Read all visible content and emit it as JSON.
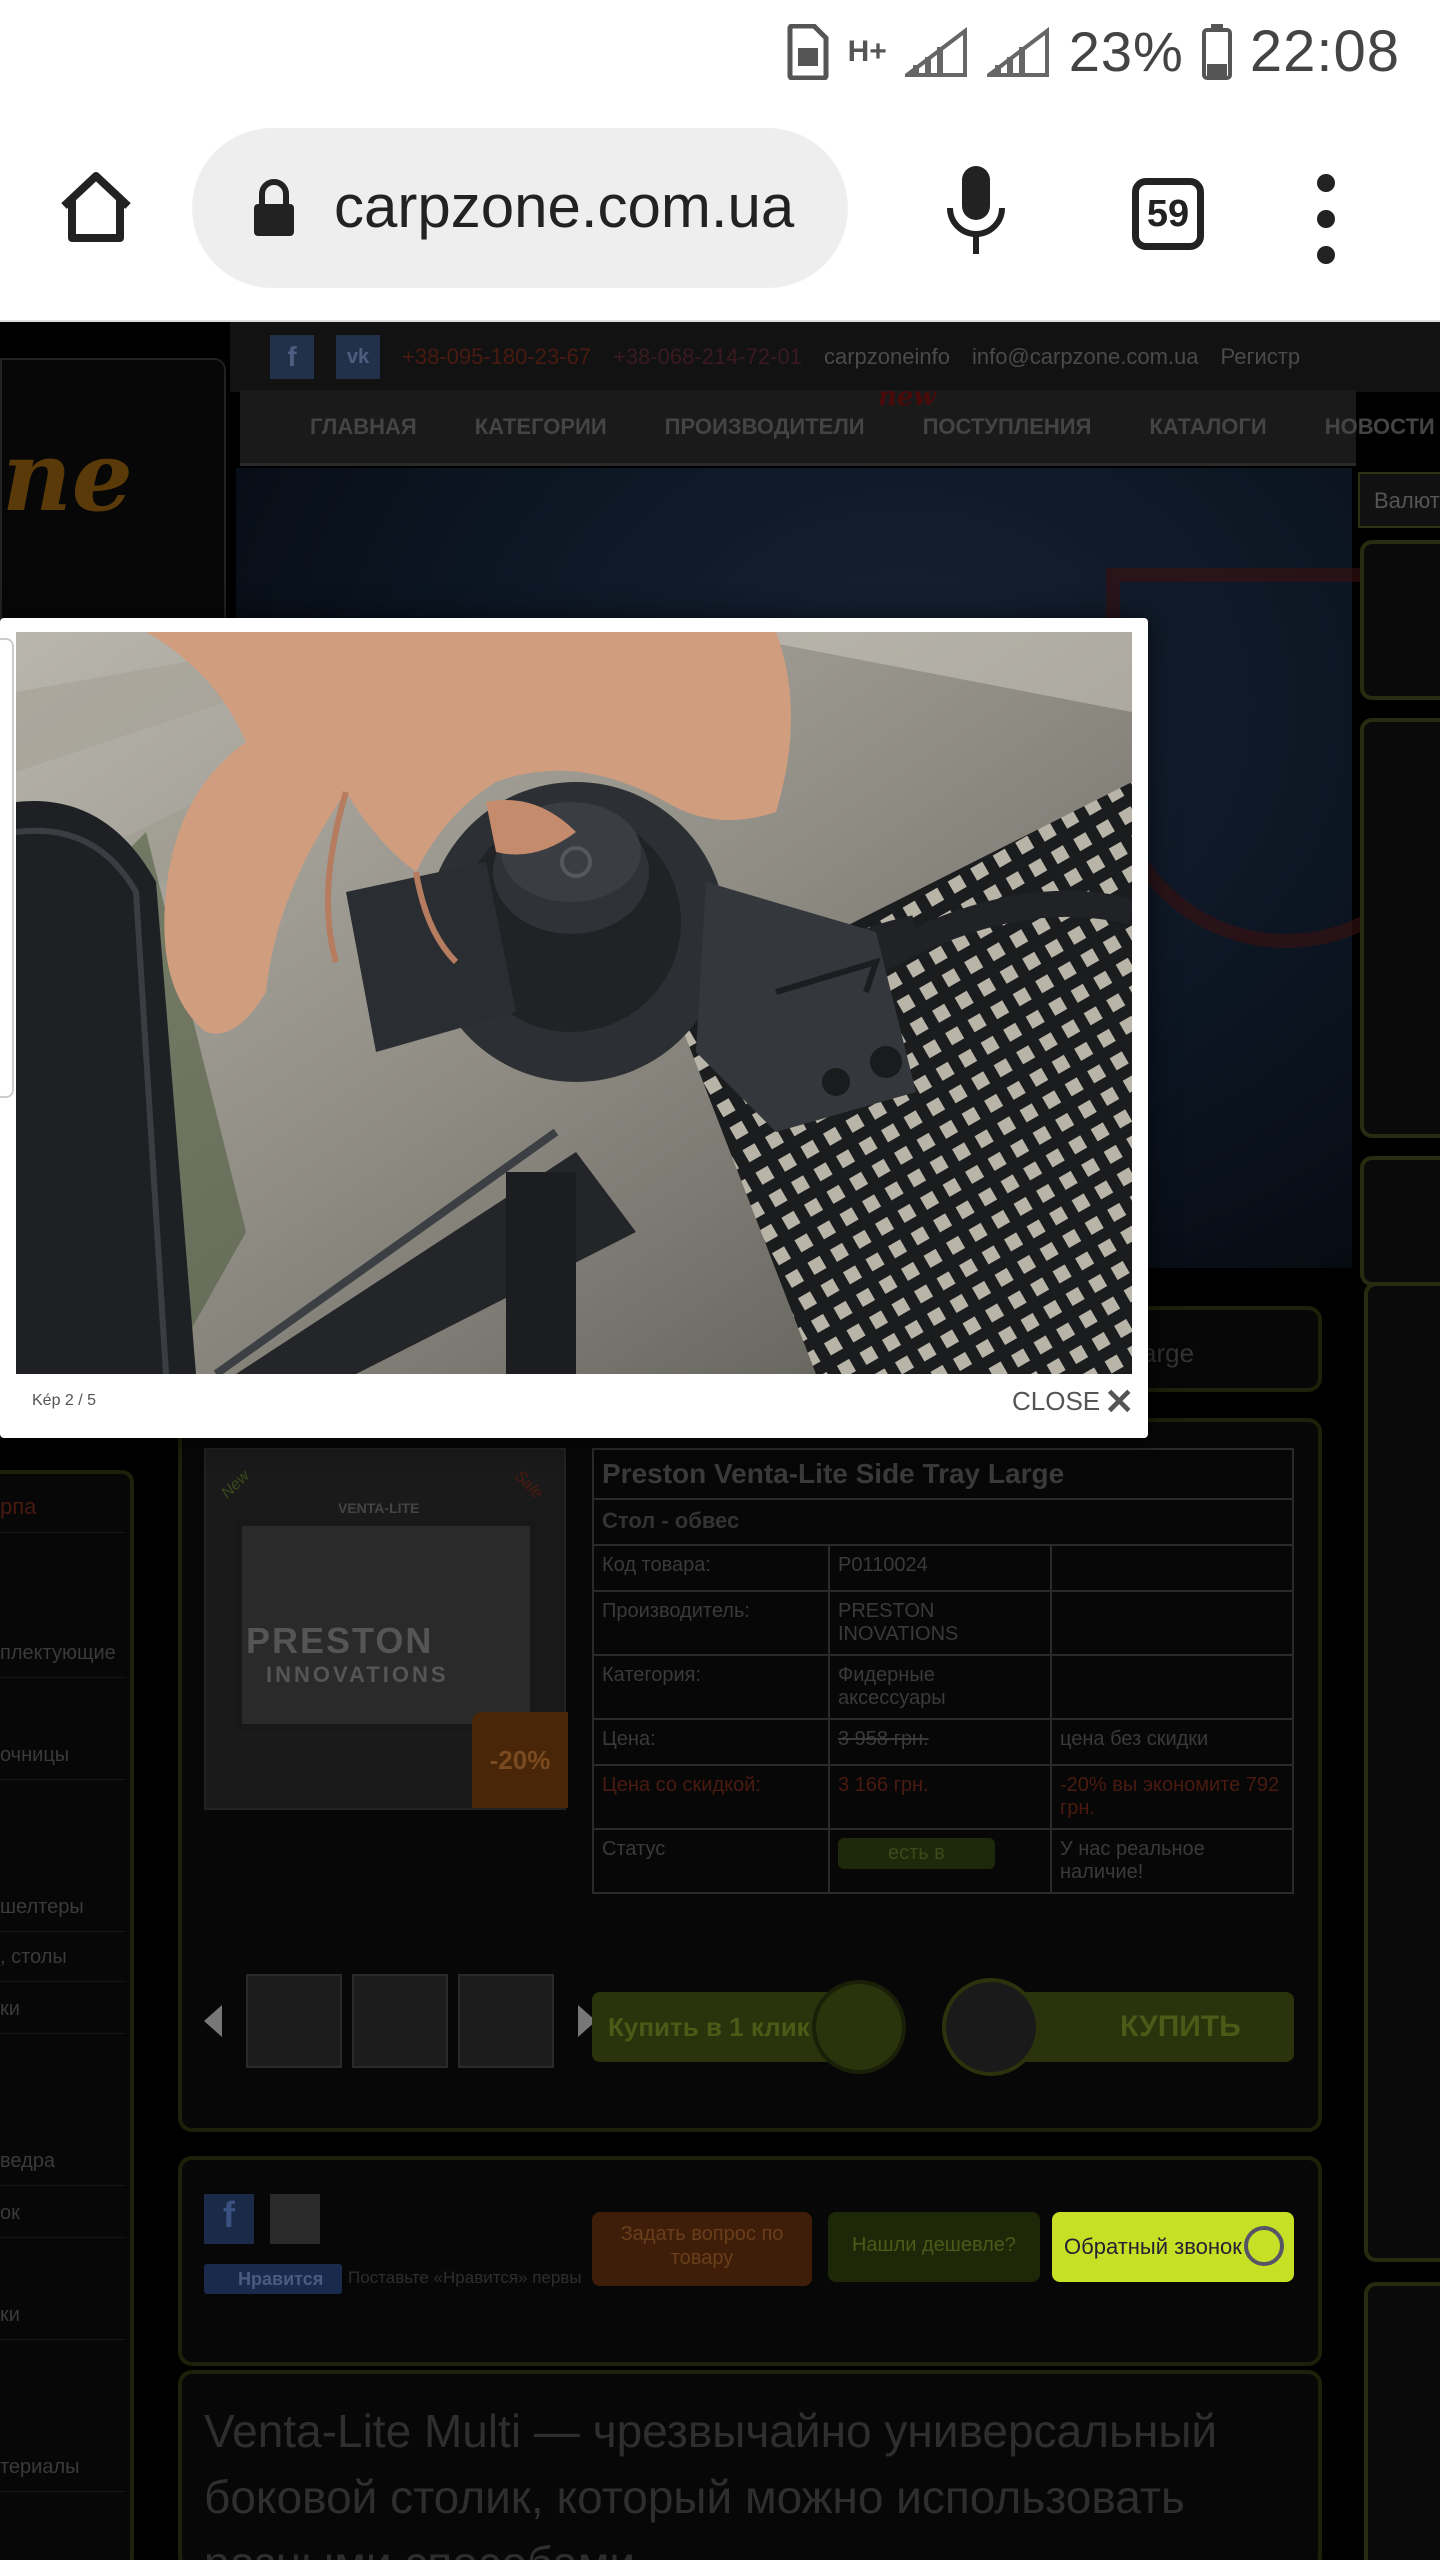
{
  "status_bar": {
    "network": "H+",
    "battery_pct": "23%",
    "time": "22:08"
  },
  "browser": {
    "url": "carpzone.com.ua",
    "tab_count": "59"
  },
  "site": {
    "topbar": {
      "phone1": "+38-095-180-23-67",
      "phone2": "+38-068-214-72-01",
      "skype": "carpzoneinfo",
      "email": "info@carpzone.com.ua",
      "register": "Регистр"
    },
    "nav": {
      "items": [
        "ГЛАВНАЯ",
        "КАТЕГОРИИ",
        "ПРОИЗВОДИТЕЛИ",
        "ПОСТУПЛЕНИЯ",
        "КАТАЛОГИ",
        "НОВОСТИ"
      ],
      "new_tag": "new"
    },
    "valuta_label": "Валюта",
    "breadcrumb_tail": "arge",
    "left_menu": [
      "рпа",
      "плектующие",
      "очницы",
      "шелтеры",
      ", столы",
      "ки",
      "ведра",
      "ок",
      "ки",
      "териалы"
    ],
    "product": {
      "image_brand": "PRESTON",
      "image_brand2": "INNOVATIONS",
      "image_top": "VENTA-LITE",
      "ribbon_new": "New",
      "ribbon_sale": "Sale",
      "discount_badge": "-20%",
      "title": "Preston Venta-Lite Side Tray Large",
      "subtitle": "Стол - обвес",
      "rows": [
        {
          "label": "Код товара:",
          "value": "P0110024",
          "note": ""
        },
        {
          "label": "Производитель:",
          "value": "PRESTON INOVATIONS",
          "note": ""
        },
        {
          "label": "Категория:",
          "value": "Фидерные аксессуары",
          "note": ""
        }
      ],
      "price_label": "Цена:",
      "price_old": "3 958 грн.",
      "price_note": "цена без скидки",
      "discount_label": "Цена со скидкой:",
      "price_new": "3 166 грн.",
      "discount_note": "-20% вы экономите 792 грн.",
      "status_label": "Статус",
      "status_value": "есть в",
      "status_note": "У нас реальное наличие!",
      "buy_one_click": "Купить в 1 клик",
      "buy": "КУПИТЬ"
    },
    "share": {
      "fb": "f",
      "like": "Нравится",
      "like_note": "Поставьте «Нравится» первы"
    },
    "actions": {
      "ask": "Задать вопрос по товару",
      "cheaper": "Нашли дешевле?",
      "callback": "Обратный звонок"
    },
    "description": "Venta-Lite Multi — чрезвычайно универсальный боковой столик, который можно использовать разными способами"
  },
  "lightbox": {
    "caption": "Kép 2 / 5",
    "close_label": "CLOSE"
  }
}
